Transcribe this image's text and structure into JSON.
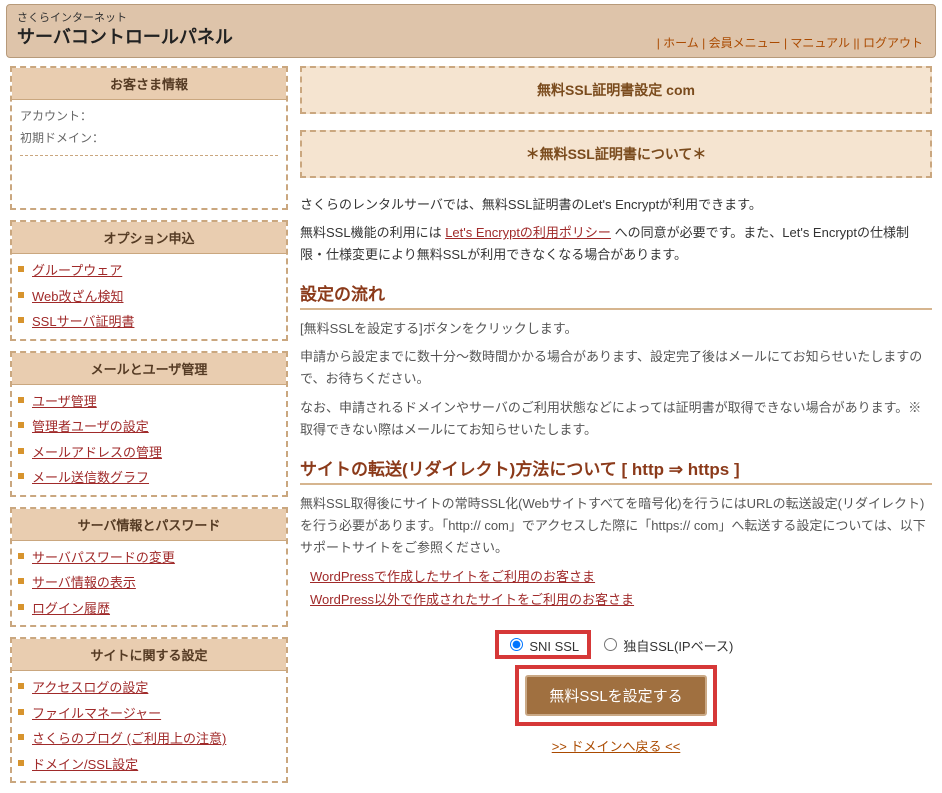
{
  "header": {
    "small": "さくらインターネット",
    "title": "サーバコントロールパネル",
    "nav": [
      {
        "sep": "|",
        "txt": "ホーム"
      },
      {
        "sep": "|",
        "txt": "会員メニュー"
      },
      {
        "sep": "|",
        "txt": "マニュアル"
      },
      {
        "sep": "||",
        "txt": "ログアウト"
      }
    ]
  },
  "side": {
    "info": {
      "head": "お客さま情報",
      "account_label": "アカウント：",
      "domain_label": "初期ドメイン："
    },
    "blocks": [
      {
        "head": "オプション申込",
        "items": [
          "グループウェア",
          "Web改ざん検知",
          "SSLサーバ証明書"
        ]
      },
      {
        "head": "メールとユーザ管理",
        "items": [
          "ユーザ管理",
          "管理者ユーザの設定",
          "メールアドレスの管理",
          "メール送信数グラフ"
        ]
      },
      {
        "head": "サーバ情報とパスワード",
        "items": [
          "サーバパスワードの変更",
          "サーバ情報の表示",
          "ログイン履歴"
        ]
      },
      {
        "head": "サイトに関する設定",
        "items": [
          "アクセスログの設定",
          "ファイルマネージャー",
          "さくらのブログ (ご利用上の注意)",
          "ドメイン/SSL設定"
        ]
      }
    ]
  },
  "main": {
    "panel1": "無料SSL証明書設定             com",
    "panel2": "＊無料SSL証明書について＊",
    "p1a": "さくらのレンタルサーバでは、無料SSL証明書のLet's Encryptが利用できます。",
    "p1b_before": "無料SSL機能の利用には ",
    "p1b_link": "Let's Encryptの利用ポリシー",
    "p1b_after": "への同意が必要です。また、Let's Encryptの仕様制限・仕様変更により無料SSLが利用できなくなる場合があります。",
    "h_flow": "設定の流れ",
    "flow1": "[無料SSLを設定する]ボタンをクリックします。",
    "flow2": "申請から設定までに数十分～数時間かかる場合があります、設定完了後はメールにてお知らせいたしますので、お待ちください。",
    "flow3": "なお、申請されるドメインやサーバのご利用状態などによっては証明書が取得できない場合があります。※取得できない際はメールにてお知らせいたします。",
    "h_redirect": "サイトの転送(リダイレクト)方法について [ http ⇒ https ]",
    "r1": "無料SSL取得後にサイトの常時SSL化(Webサイトすべてを暗号化)を行うにはURLの転送設定(リダイレクト)を行う必要があります。「http://            com」でアクセスした際に「https://           com」へ転送する設定については、以下サポートサイトをご参照ください。",
    "wp1": "WordPressで作成したサイトをご利用のお客さま",
    "wp2": "WordPress以外で作成されたサイトをご利用のお客さま",
    "radio1": "SNI SSL",
    "radio2": "独自SSL(IPベース)",
    "btn": "無料SSLを設定する",
    "back": ">> ドメインへ戻る <<"
  }
}
